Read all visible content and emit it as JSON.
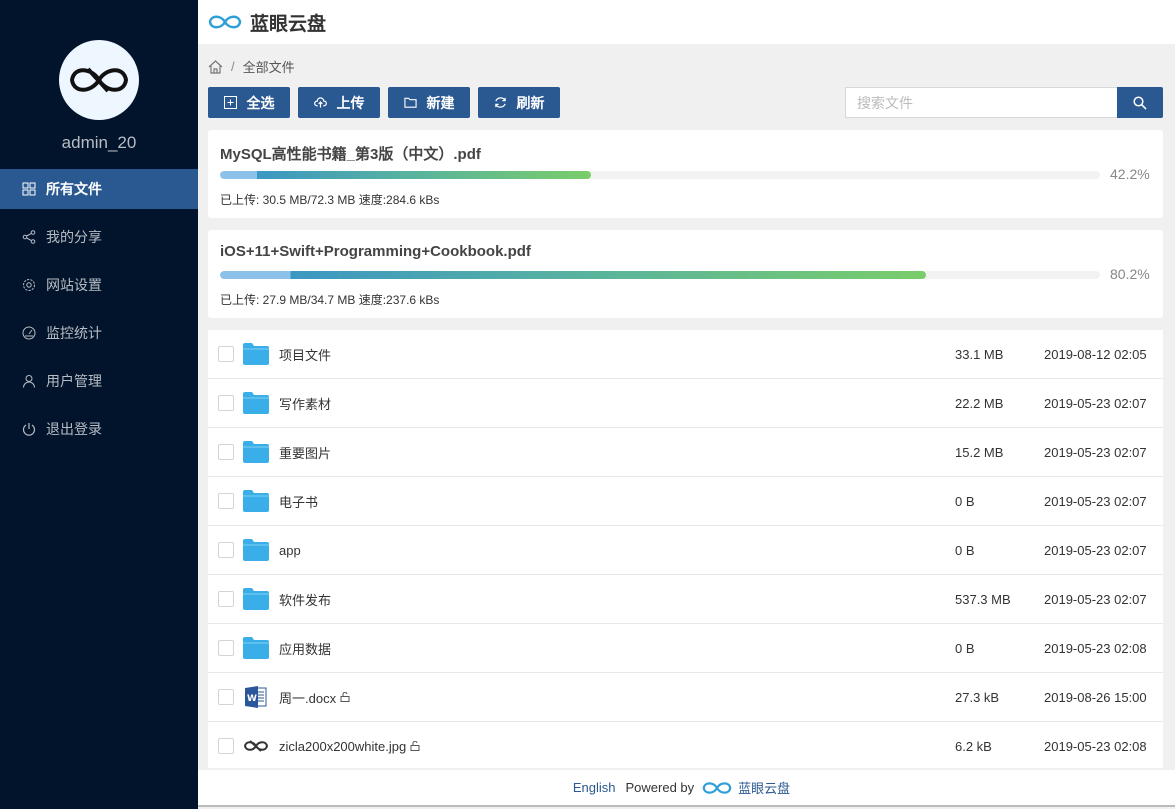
{
  "app": {
    "title": "蓝眼云盘"
  },
  "user": {
    "name": "admin_20"
  },
  "sidebar": {
    "items": [
      {
        "label": "所有文件",
        "icon": "grid-icon",
        "active": true
      },
      {
        "label": "我的分享",
        "icon": "share-icon"
      },
      {
        "label": "网站设置",
        "icon": "gear-icon"
      },
      {
        "label": "监控统计",
        "icon": "dashboard-icon"
      },
      {
        "label": "用户管理",
        "icon": "users-icon"
      },
      {
        "label": "退出登录",
        "icon": "power-icon"
      }
    ]
  },
  "breadcrumb": {
    "current": "全部文件"
  },
  "toolbar": {
    "select_all": "全选",
    "upload": "上传",
    "new": "新建",
    "refresh": "刷新",
    "search_placeholder": "搜索文件"
  },
  "uploads": [
    {
      "name": "MySQL高性能书籍_第3版（中文）.pdf",
      "percent": 42.2,
      "percent_label": "42.2%",
      "info": "已上传: 30.5 MB/72.3 MB 速度:284.6 kBs"
    },
    {
      "name": "iOS+11+Swift+Programming+Cookbook.pdf",
      "percent": 80.2,
      "percent_label": "80.2%",
      "info": "已上传: 27.9 MB/34.7 MB 速度:237.6 kBs"
    }
  ],
  "files": [
    {
      "name": "项目文件",
      "type": "folder",
      "size": "33.1 MB",
      "date": "2019-08-12 02:05"
    },
    {
      "name": "写作素材",
      "type": "folder",
      "size": "22.2 MB",
      "date": "2019-05-23 02:07"
    },
    {
      "name": "重要图片",
      "type": "folder",
      "size": "15.2 MB",
      "date": "2019-05-23 02:07"
    },
    {
      "name": "电子书",
      "type": "folder",
      "size": "0 B",
      "date": "2019-05-23 02:07"
    },
    {
      "name": "app",
      "type": "folder",
      "size": "0 B",
      "date": "2019-05-23 02:07"
    },
    {
      "name": "软件发布",
      "type": "folder",
      "size": "537.3 MB",
      "date": "2019-05-23 02:07"
    },
    {
      "name": "应用数据",
      "type": "folder",
      "size": "0 B",
      "date": "2019-05-23 02:08"
    },
    {
      "name": "周一.docx",
      "type": "word",
      "size": "27.3 kB",
      "date": "2019-08-26 15:00",
      "unlocked": true
    },
    {
      "name": "zicla200x200white.jpg",
      "type": "image",
      "size": "6.2 kB",
      "date": "2019-05-23 02:08",
      "unlocked": true
    }
  ],
  "footer": {
    "language": "English",
    "powered_by": "Powered by",
    "brand": "蓝眼云盘"
  },
  "colors": {
    "sidebar": "#02142b",
    "accent": "#2a5891",
    "folder": "#3aaee8"
  }
}
